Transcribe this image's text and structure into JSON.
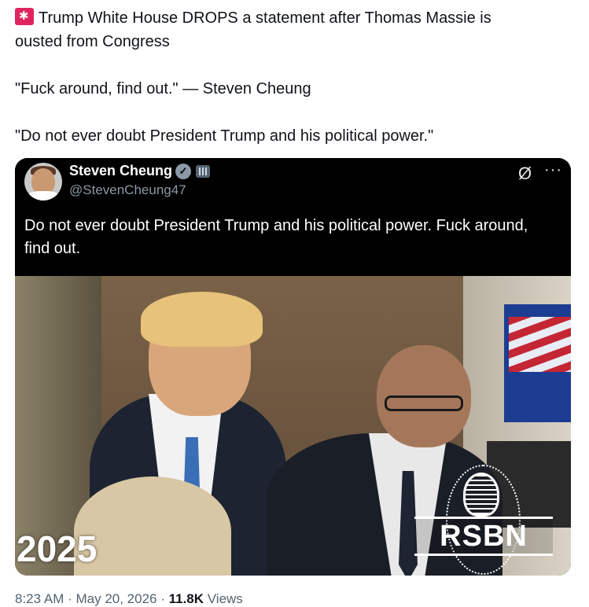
{
  "tweet": {
    "line1": "Trump White House DROPS a statement after Thomas Massie is",
    "line2": "ousted from Congress",
    "line3": "\"Fuck around, find out.\" — Steven Cheung",
    "line4": "\"Do not ever doubt President Trump and his political power.\""
  },
  "quoted": {
    "name": "Steven Cheung",
    "handle": "@StevenCheung47",
    "text_line1": "Do not ever doubt President Trump and his political power. Fuck around,",
    "text_line2": "find out.",
    "verified_glyph": "✓",
    "x_glyph": "Ø",
    "more_glyph": "···"
  },
  "video": {
    "overlay_year": "2025",
    "watermark": "RSBN"
  },
  "meta": {
    "time": "8:23 AM",
    "sep1": " · ",
    "date": "May 20, 2026",
    "sep2": " · ",
    "views_count": "11.8K",
    "views_label": " Views"
  },
  "icons": {
    "siren": "siren-emoji",
    "verified": "verified-badge-icon",
    "affiliate": "affiliate-badge-icon",
    "x_logo": "x-logo-icon",
    "more": "more-icon"
  },
  "colors": {
    "verified": "#8b98a5",
    "siren": "#e0245e",
    "muted_text": "#536471"
  }
}
